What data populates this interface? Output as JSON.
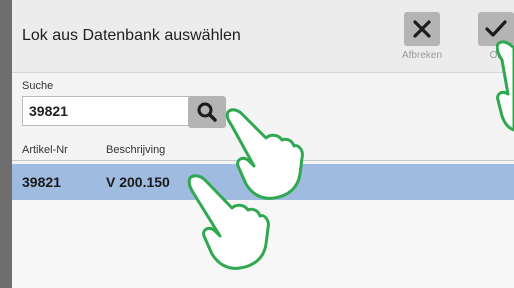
{
  "dialog": {
    "title": "Lok aus Datenbank auswählen",
    "buttons": {
      "cancel_label": "Afbreken",
      "ok_label": "Ok"
    }
  },
  "search": {
    "label": "Suche",
    "value": "39821",
    "button_icon": "search-icon"
  },
  "table": {
    "columns": [
      "Artikel-Nr",
      "Beschrijving"
    ],
    "rows": [
      {
        "artikel_nr": "39821",
        "beschrijving": "V 200.150",
        "selected": true
      }
    ]
  },
  "colors": {
    "selection": "#9fbce0",
    "pointer_outline": "#2fa84f",
    "button_bg": "#b4b4b4"
  },
  "icons": [
    "close-icon",
    "check-icon",
    "search-icon",
    "pointer-hand-icon"
  ]
}
